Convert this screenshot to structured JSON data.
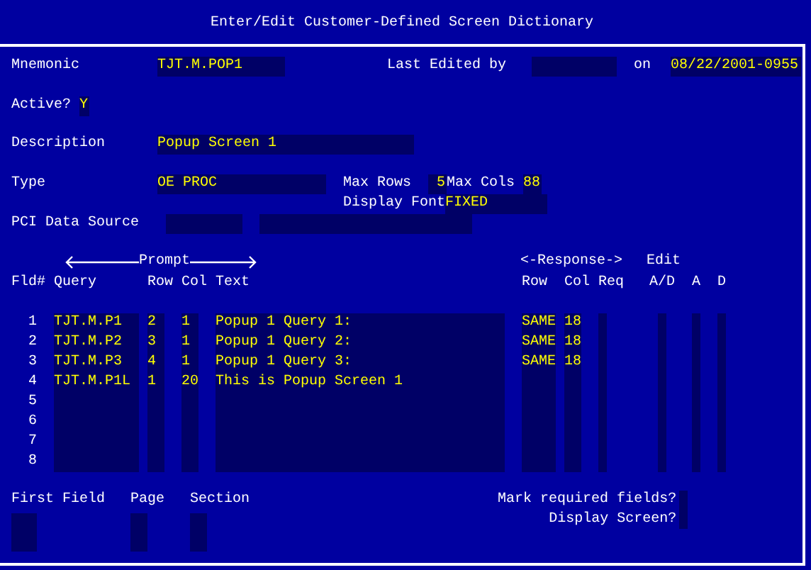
{
  "window": {
    "title": "Enter/Edit Customer-Defined Screen Dictionary"
  },
  "header": {
    "mnemonic": {
      "label": "Mnemonic",
      "value": "TJT.M.POP1"
    },
    "last_edited_by": {
      "label": "Last Edited by"
    },
    "on": {
      "label": "on",
      "value": "08/22/2001-0955"
    },
    "active": {
      "label": "Active?",
      "value": "Y"
    },
    "description": {
      "label": "Description",
      "value": "Popup Screen 1"
    },
    "type": {
      "label": "Type",
      "value": "OE PROC"
    },
    "max_rows": {
      "label": "Max Rows",
      "value": "5"
    },
    "max_cols": {
      "label": "Max Cols",
      "value": "88"
    },
    "display_font": {
      "label": "Display Font",
      "value": "FIXED"
    },
    "pci_data_source": {
      "label": "PCI Data Source"
    }
  },
  "table": {
    "prompt_group": "Prompt",
    "response_group": "<-Response->",
    "edit_group": "Edit",
    "columns": [
      "Fld#",
      "Query",
      "Row",
      "Col",
      "Text",
      "Row",
      "Col",
      "Req",
      "A/D",
      "A",
      "D"
    ],
    "rows": [
      {
        "fld": "1",
        "query": "TJT.M.P1",
        "row": "2",
        "col": "1",
        "text": "Popup 1 Query 1:",
        "response_row": "SAME",
        "response_col": "18"
      },
      {
        "fld": "2",
        "query": "TJT.M.P2",
        "row": "3",
        "col": "1",
        "text": "Popup 1 Query 2:",
        "response_row": "SAME",
        "response_col": "18"
      },
      {
        "fld": "3",
        "query": "TJT.M.P3",
        "row": "4",
        "col": "1",
        "text": "Popup 1 Query 3:",
        "response_row": "SAME",
        "response_col": "18"
      },
      {
        "fld": "4",
        "query": "TJT.M.P1L",
        "row": "1",
        "col": "20",
        "text": "This is Popup Screen 1"
      },
      {
        "fld": "5"
      },
      {
        "fld": "6"
      },
      {
        "fld": "7"
      },
      {
        "fld": "8"
      }
    ]
  },
  "footer": {
    "first_field": "First Field",
    "page": "Page",
    "section": "Section",
    "mark_required": "Mark required fields?",
    "display_screen": "Display Screen?"
  }
}
